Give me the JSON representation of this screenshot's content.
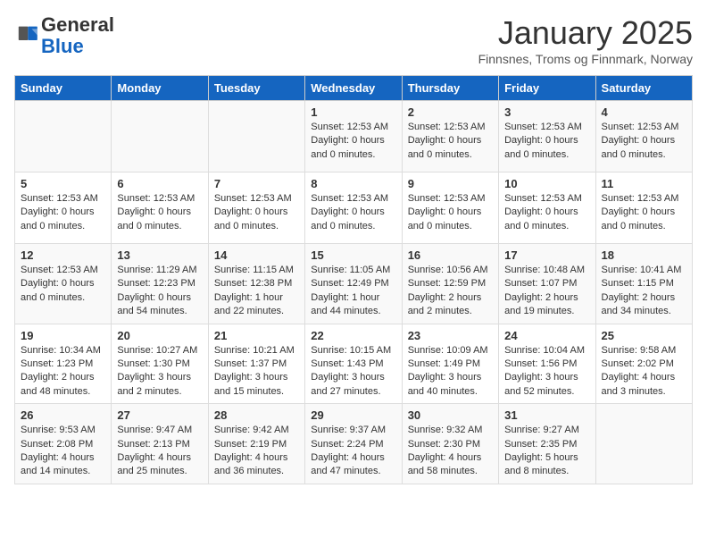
{
  "header": {
    "logo_general": "General",
    "logo_blue": "Blue",
    "month_title": "January 2025",
    "subtitle": "Finnsnes, Troms og Finnmark, Norway"
  },
  "days_of_week": [
    "Sunday",
    "Monday",
    "Tuesday",
    "Wednesday",
    "Thursday",
    "Friday",
    "Saturday"
  ],
  "weeks": [
    [
      {
        "day": "",
        "content": ""
      },
      {
        "day": "",
        "content": ""
      },
      {
        "day": "",
        "content": ""
      },
      {
        "day": "1",
        "content": "Sunset: 12:53 AM\nDaylight: 0 hours and 0 minutes."
      },
      {
        "day": "2",
        "content": "Sunset: 12:53 AM\nDaylight: 0 hours and 0 minutes."
      },
      {
        "day": "3",
        "content": "Sunset: 12:53 AM\nDaylight: 0 hours and 0 minutes."
      },
      {
        "day": "4",
        "content": "Sunset: 12:53 AM\nDaylight: 0 hours and 0 minutes."
      }
    ],
    [
      {
        "day": "5",
        "content": "Sunset: 12:53 AM\nDaylight: 0 hours and 0 minutes."
      },
      {
        "day": "6",
        "content": "Sunset: 12:53 AM\nDaylight: 0 hours and 0 minutes."
      },
      {
        "day": "7",
        "content": "Sunset: 12:53 AM\nDaylight: 0 hours and 0 minutes."
      },
      {
        "day": "8",
        "content": "Sunset: 12:53 AM\nDaylight: 0 hours and 0 minutes."
      },
      {
        "day": "9",
        "content": "Sunset: 12:53 AM\nDaylight: 0 hours and 0 minutes."
      },
      {
        "day": "10",
        "content": "Sunset: 12:53 AM\nDaylight: 0 hours and 0 minutes."
      },
      {
        "day": "11",
        "content": "Sunset: 12:53 AM\nDaylight: 0 hours and 0 minutes."
      }
    ],
    [
      {
        "day": "12",
        "content": "Sunset: 12:53 AM\nDaylight: 0 hours and 0 minutes."
      },
      {
        "day": "13",
        "content": "Sunrise: 11:29 AM\nSunset: 12:23 PM\nDaylight: 0 hours and 54 minutes."
      },
      {
        "day": "14",
        "content": "Sunrise: 11:15 AM\nSunset: 12:38 PM\nDaylight: 1 hour and 22 minutes."
      },
      {
        "day": "15",
        "content": "Sunrise: 11:05 AM\nSunset: 12:49 PM\nDaylight: 1 hour and 44 minutes."
      },
      {
        "day": "16",
        "content": "Sunrise: 10:56 AM\nSunset: 12:59 PM\nDaylight: 2 hours and 2 minutes."
      },
      {
        "day": "17",
        "content": "Sunrise: 10:48 AM\nSunset: 1:07 PM\nDaylight: 2 hours and 19 minutes."
      },
      {
        "day": "18",
        "content": "Sunrise: 10:41 AM\nSunset: 1:15 PM\nDaylight: 2 hours and 34 minutes."
      }
    ],
    [
      {
        "day": "19",
        "content": "Sunrise: 10:34 AM\nSunset: 1:23 PM\nDaylight: 2 hours and 48 minutes."
      },
      {
        "day": "20",
        "content": "Sunrise: 10:27 AM\nSunset: 1:30 PM\nDaylight: 3 hours and 2 minutes."
      },
      {
        "day": "21",
        "content": "Sunrise: 10:21 AM\nSunset: 1:37 PM\nDaylight: 3 hours and 15 minutes."
      },
      {
        "day": "22",
        "content": "Sunrise: 10:15 AM\nSunset: 1:43 PM\nDaylight: 3 hours and 27 minutes."
      },
      {
        "day": "23",
        "content": "Sunrise: 10:09 AM\nSunset: 1:49 PM\nDaylight: 3 hours and 40 minutes."
      },
      {
        "day": "24",
        "content": "Sunrise: 10:04 AM\nSunset: 1:56 PM\nDaylight: 3 hours and 52 minutes."
      },
      {
        "day": "25",
        "content": "Sunrise: 9:58 AM\nSunset: 2:02 PM\nDaylight: 4 hours and 3 minutes."
      }
    ],
    [
      {
        "day": "26",
        "content": "Sunrise: 9:53 AM\nSunset: 2:08 PM\nDaylight: 4 hours and 14 minutes."
      },
      {
        "day": "27",
        "content": "Sunrise: 9:47 AM\nSunset: 2:13 PM\nDaylight: 4 hours and 25 minutes."
      },
      {
        "day": "28",
        "content": "Sunrise: 9:42 AM\nSunset: 2:19 PM\nDaylight: 4 hours and 36 minutes."
      },
      {
        "day": "29",
        "content": "Sunrise: 9:37 AM\nSunset: 2:24 PM\nDaylight: 4 hours and 47 minutes."
      },
      {
        "day": "30",
        "content": "Sunrise: 9:32 AM\nSunset: 2:30 PM\nDaylight: 4 hours and 58 minutes."
      },
      {
        "day": "31",
        "content": "Sunrise: 9:27 AM\nSunset: 2:35 PM\nDaylight: 5 hours and 8 minutes."
      },
      {
        "day": "",
        "content": ""
      }
    ]
  ]
}
